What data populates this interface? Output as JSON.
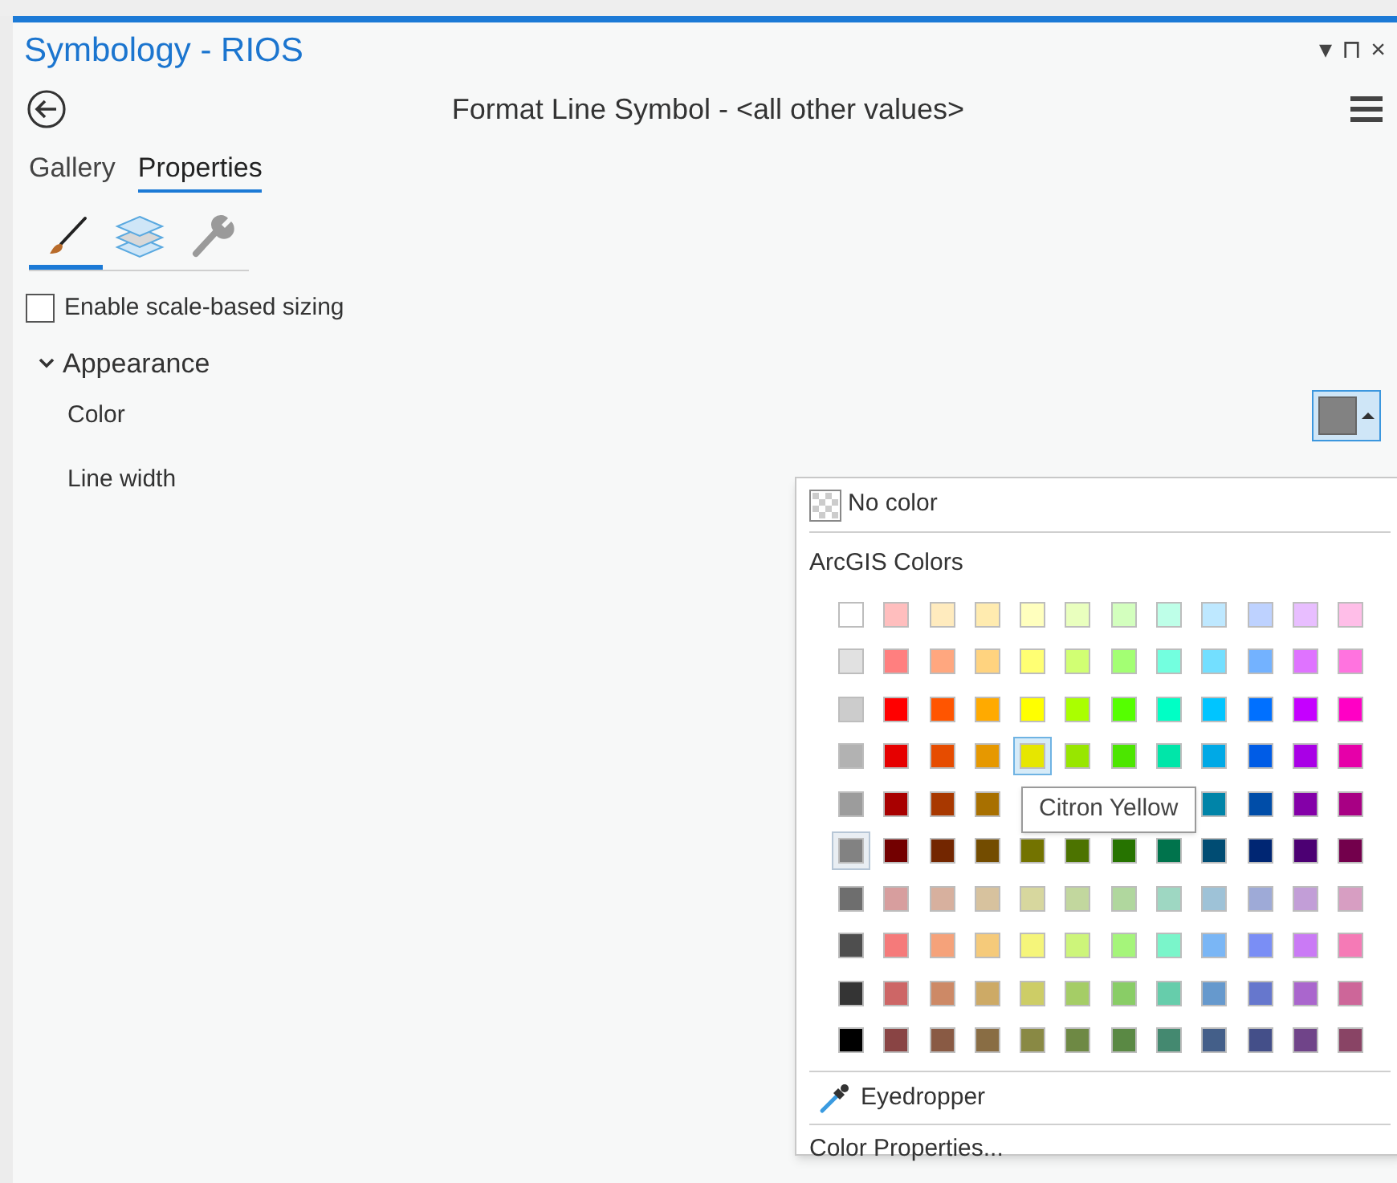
{
  "pane": {
    "title": "Symbology - RIOS",
    "controls": [
      "▾",
      "⊓",
      "×"
    ]
  },
  "header": {
    "title": "Format Line Symbol - <all other values>"
  },
  "tabs": [
    {
      "label": "Gallery",
      "selected": false
    },
    {
      "label": "Properties",
      "selected": true
    }
  ],
  "subtabs": [
    {
      "kind": "brush",
      "selected": true
    },
    {
      "kind": "layers",
      "selected": false
    },
    {
      "kind": "wrench",
      "selected": false
    }
  ],
  "scale_sizing": {
    "label": "Enable scale-based sizing",
    "checked": false
  },
  "section": {
    "label": "Appearance",
    "expanded": true
  },
  "properties": [
    {
      "label": "Color",
      "kind": "color"
    },
    {
      "label": "Line width",
      "kind": "plain"
    }
  ],
  "color_menu": {
    "no_color": "No color",
    "group_title": "ArcGIS Colors",
    "eyedropper": "Eyedropper",
    "more": "Color Properties...",
    "tooltip": "Citron Yellow",
    "swatches": [
      [
        {
          "color": "#ffffff",
          "selected": false,
          "hovered": false
        },
        {
          "color": "#ffbebe",
          "selected": false,
          "hovered": false
        },
        {
          "color": "#ffebbe",
          "selected": false,
          "hovered": false
        },
        {
          "color": "#ffebaf",
          "selected": false,
          "hovered": false
        },
        {
          "color": "#ffffbe",
          "selected": false,
          "hovered": false
        },
        {
          "color": "#e9ffbe",
          "selected": false,
          "hovered": false
        },
        {
          "color": "#d3ffbe",
          "selected": false,
          "hovered": false
        },
        {
          "color": "#beffe8",
          "selected": false,
          "hovered": false
        },
        {
          "color": "#bee8ff",
          "selected": false,
          "hovered": false
        },
        {
          "color": "#bed2ff",
          "selected": false,
          "hovered": false
        },
        {
          "color": "#e8beff",
          "selected": false,
          "hovered": false
        },
        {
          "color": "#ffbee8",
          "selected": false,
          "hovered": false
        }
      ],
      [
        {
          "color": "#e1e1e1",
          "selected": false,
          "hovered": false
        },
        {
          "color": "#ff7f7f",
          "selected": false,
          "hovered": false
        },
        {
          "color": "#ffa77f",
          "selected": false,
          "hovered": false
        },
        {
          "color": "#ffd37f",
          "selected": false,
          "hovered": false
        },
        {
          "color": "#ffff73",
          "selected": false,
          "hovered": false
        },
        {
          "color": "#d1ff73",
          "selected": false,
          "hovered": false
        },
        {
          "color": "#a3ff73",
          "selected": false,
          "hovered": false
        },
        {
          "color": "#73ffdf",
          "selected": false,
          "hovered": false
        },
        {
          "color": "#73dfff",
          "selected": false,
          "hovered": false
        },
        {
          "color": "#73b2ff",
          "selected": false,
          "hovered": false
        },
        {
          "color": "#df73ff",
          "selected": false,
          "hovered": false
        },
        {
          "color": "#ff73df",
          "selected": false,
          "hovered": false
        }
      ],
      [
        {
          "color": "#cccccc",
          "selected": false,
          "hovered": false
        },
        {
          "color": "#ff0000",
          "selected": false,
          "hovered": false
        },
        {
          "color": "#ff5500",
          "selected": false,
          "hovered": false
        },
        {
          "color": "#ffaa00",
          "selected": false,
          "hovered": false
        },
        {
          "color": "#ffff00",
          "selected": false,
          "hovered": false
        },
        {
          "color": "#aaff00",
          "selected": false,
          "hovered": false
        },
        {
          "color": "#55ff00",
          "selected": false,
          "hovered": false
        },
        {
          "color": "#00ffc5",
          "selected": false,
          "hovered": false
        },
        {
          "color": "#00c5ff",
          "selected": false,
          "hovered": false
        },
        {
          "color": "#0070ff",
          "selected": false,
          "hovered": false
        },
        {
          "color": "#c500ff",
          "selected": false,
          "hovered": false
        },
        {
          "color": "#ff00c5",
          "selected": false,
          "hovered": false
        }
      ],
      [
        {
          "color": "#b2b2b2",
          "selected": false,
          "hovered": false
        },
        {
          "color": "#e60000",
          "selected": false,
          "hovered": false
        },
        {
          "color": "#e64c00",
          "selected": false,
          "hovered": false
        },
        {
          "color": "#e69800",
          "selected": false,
          "hovered": false
        },
        {
          "color": "#e6e600",
          "selected": false,
          "hovered": true
        },
        {
          "color": "#98e600",
          "selected": false,
          "hovered": false
        },
        {
          "color": "#4ce600",
          "selected": false,
          "hovered": false
        },
        {
          "color": "#00e6a9",
          "selected": false,
          "hovered": false
        },
        {
          "color": "#00a9e6",
          "selected": false,
          "hovered": false
        },
        {
          "color": "#005ce6",
          "selected": false,
          "hovered": false
        },
        {
          "color": "#a900e6",
          "selected": false,
          "hovered": false
        },
        {
          "color": "#e600a9",
          "selected": false,
          "hovered": false
        }
      ],
      [
        {
          "color": "#9c9c9c",
          "selected": false,
          "hovered": false
        },
        {
          "color": "#a80000",
          "selected": false,
          "hovered": false
        },
        {
          "color": "#a83800",
          "selected": false,
          "hovered": false
        },
        {
          "color": "#a87000",
          "selected": false,
          "hovered": false
        },
        {
          "kind": "covered"
        },
        {
          "kind": "covered"
        },
        {
          "kind": "covered"
        },
        {
          "kind": "covered"
        },
        {
          "color": "#0084a8",
          "selected": false,
          "hovered": false
        },
        {
          "color": "#004da8",
          "selected": false,
          "hovered": false
        },
        {
          "color": "#8400a8",
          "selected": false,
          "hovered": false
        },
        {
          "color": "#a80084",
          "selected": false,
          "hovered": false
        }
      ],
      [
        {
          "color": "#828282",
          "selected": true,
          "hovered": false
        },
        {
          "color": "#730000",
          "selected": false,
          "hovered": false
        },
        {
          "color": "#732600",
          "selected": false,
          "hovered": false
        },
        {
          "color": "#734c00",
          "selected": false,
          "hovered": false
        },
        {
          "color": "#737300",
          "selected": false,
          "hovered": false
        },
        {
          "color": "#4c7300",
          "selected": false,
          "hovered": false
        },
        {
          "color": "#267300",
          "selected": false,
          "hovered": false
        },
        {
          "color": "#00734c",
          "selected": false,
          "hovered": false
        },
        {
          "color": "#004c73",
          "selected": false,
          "hovered": false
        },
        {
          "color": "#002673",
          "selected": false,
          "hovered": false
        },
        {
          "color": "#4c0073",
          "selected": false,
          "hovered": false
        },
        {
          "color": "#73004c",
          "selected": false,
          "hovered": false
        }
      ],
      [
        {
          "color": "#6e6e6e",
          "selected": false,
          "hovered": false
        },
        {
          "color": "#d79e9e",
          "selected": false,
          "hovered": false
        },
        {
          "color": "#d7b09e",
          "selected": false,
          "hovered": false
        },
        {
          "color": "#d7c29e",
          "selected": false,
          "hovered": false
        },
        {
          "color": "#d7d79e",
          "selected": false,
          "hovered": false
        },
        {
          "color": "#c2d79e",
          "selected": false,
          "hovered": false
        },
        {
          "color": "#b0d79e",
          "selected": false,
          "hovered": false
        },
        {
          "color": "#9ed7c2",
          "selected": false,
          "hovered": false
        },
        {
          "color": "#9ec2d7",
          "selected": false,
          "hovered": false
        },
        {
          "color": "#9eaad7",
          "selected": false,
          "hovered": false
        },
        {
          "color": "#c29ed7",
          "selected": false,
          "hovered": false
        },
        {
          "color": "#d79ec2",
          "selected": false,
          "hovered": false
        }
      ],
      [
        {
          "color": "#4e4e4e",
          "selected": false,
          "hovered": false
        },
        {
          "color": "#f57a7a",
          "selected": false,
          "hovered": false
        },
        {
          "color": "#f5a27a",
          "selected": false,
          "hovered": false
        },
        {
          "color": "#f5ca7a",
          "selected": false,
          "hovered": false
        },
        {
          "color": "#f5f57a",
          "selected": false,
          "hovered": false
        },
        {
          "color": "#cdf57a",
          "selected": false,
          "hovered": false
        },
        {
          "color": "#a5f57a",
          "selected": false,
          "hovered": false
        },
        {
          "color": "#7af5ca",
          "selected": false,
          "hovered": false
        },
        {
          "color": "#7ab6f5",
          "selected": false,
          "hovered": false
        },
        {
          "color": "#7a8ef5",
          "selected": false,
          "hovered": false
        },
        {
          "color": "#ca7af5",
          "selected": false,
          "hovered": false
        },
        {
          "color": "#f57ab6",
          "selected": false,
          "hovered": false
        }
      ],
      [
        {
          "color": "#343434",
          "selected": false,
          "hovered": false
        },
        {
          "color": "#cd6666",
          "selected": false,
          "hovered": false
        },
        {
          "color": "#cd8966",
          "selected": false,
          "hovered": false
        },
        {
          "color": "#cdaa66",
          "selected": false,
          "hovered": false
        },
        {
          "color": "#cdcd66",
          "selected": false,
          "hovered": false
        },
        {
          "color": "#a5cd66",
          "selected": false,
          "hovered": false
        },
        {
          "color": "#89cd66",
          "selected": false,
          "hovered": false
        },
        {
          "color": "#66cdab",
          "selected": false,
          "hovered": false
        },
        {
          "color": "#6699cd",
          "selected": false,
          "hovered": false
        },
        {
          "color": "#6677cd",
          "selected": false,
          "hovered": false
        },
        {
          "color": "#aa66cd",
          "selected": false,
          "hovered": false
        },
        {
          "color": "#cd6699",
          "selected": false,
          "hovered": false
        }
      ],
      [
        {
          "color": "#000000",
          "selected": false,
          "hovered": false
        },
        {
          "color": "#894444",
          "selected": false,
          "hovered": false
        },
        {
          "color": "#895a44",
          "selected": false,
          "hovered": false
        },
        {
          "color": "#896d44",
          "selected": false,
          "hovered": false
        },
        {
          "color": "#898944",
          "selected": false,
          "hovered": false
        },
        {
          "color": "#6e8944",
          "selected": false,
          "hovered": false
        },
        {
          "color": "#5a8944",
          "selected": false,
          "hovered": false
        },
        {
          "color": "#448970",
          "selected": false,
          "hovered": false
        },
        {
          "color": "#445f89",
          "selected": false,
          "hovered": false
        },
        {
          "color": "#444f89",
          "selected": false,
          "hovered": false
        },
        {
          "color": "#704489",
          "selected": false,
          "hovered": false
        },
        {
          "color": "#894465",
          "selected": false,
          "hovered": false
        }
      ]
    ]
  }
}
